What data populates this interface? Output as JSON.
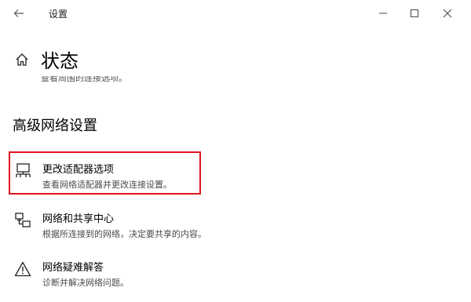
{
  "window": {
    "title": "设置"
  },
  "header": {
    "title": "状态"
  },
  "scrolled_text": "查看周围的连接选项。",
  "section": {
    "title": "高级网络设置"
  },
  "items": [
    {
      "title": "更改适配器选项",
      "desc": "查看网络适配器并更改连接设置。",
      "icon": "adapter-icon"
    },
    {
      "title": "网络和共享中心",
      "desc": "根据所连接到的网络，决定要共享的内容。",
      "icon": "network-sharing-icon"
    },
    {
      "title": "网络疑难解答",
      "desc": "诊断并解决网络问题。",
      "icon": "warning-icon"
    }
  ],
  "colors": {
    "highlight": "#e0141e"
  }
}
